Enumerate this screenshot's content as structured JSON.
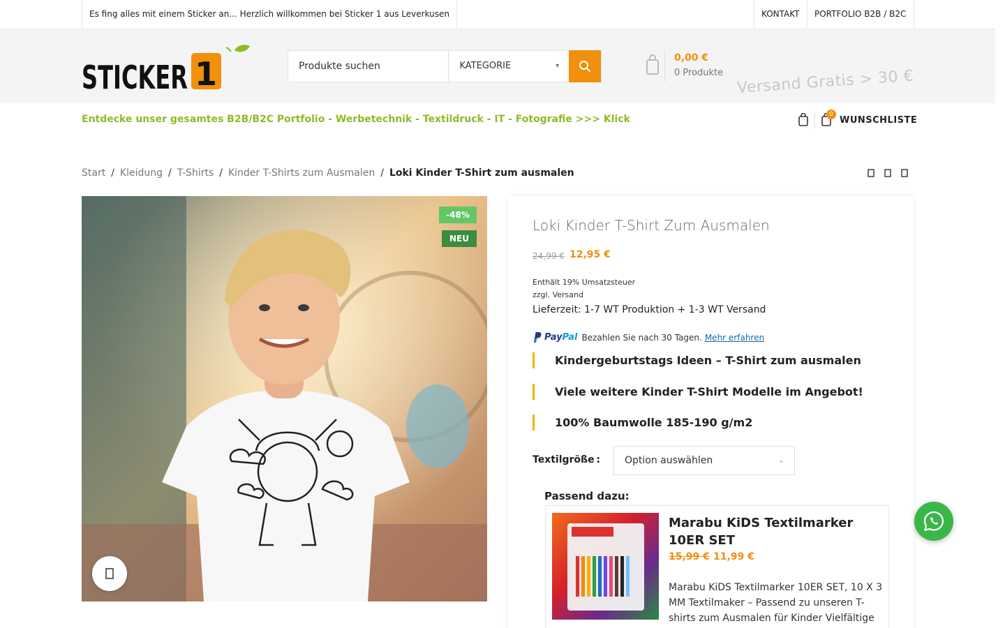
{
  "topbar": {
    "welcome": "Es fing alles mit einem Sticker an... Herzlich willkommen bei Sticker 1 aus Leverkusen",
    "links": [
      "KONTAKT",
      "PORTFOLIO B2B / B2C"
    ]
  },
  "header": {
    "logo_text": "STICKER",
    "logo_number": "1",
    "search_placeholder": "Produkte suchen",
    "category_label": "KATEGORIE",
    "cart_total": "0,00 €",
    "cart_count": "0 Produkte",
    "shipping_ticker": "Versand Gratis > 30 €"
  },
  "promo": "Entdecke unser gesamtes B2B/B2C Portfolio - Werbetechnik - Textildruck - IT - Fotografie >>> Klick",
  "wishlist": {
    "count": "0",
    "label": "WUNSCHLISTE"
  },
  "breadcrumb": {
    "items": [
      "Start",
      "Kleidung",
      "T-Shirts",
      "Kinder T-Shirts zum Ausmalen"
    ],
    "separator": "/",
    "current": "Loki Kinder T-Shirt zum ausmalen"
  },
  "gallery": {
    "badge_sale": "-48%",
    "badge_new": "NEU"
  },
  "product": {
    "title": "Loki Kinder T-Shirt Zum Ausmalen",
    "price_old": "24,99 €",
    "price_new": "12,95 €",
    "tax_note": "Enthält 19% Umsatzsteuer",
    "shipping_note": "zzgl. Versand",
    "delivery": "Lieferzeit: 1-7 WT Produktion + 1-3 WT Versand",
    "paypal": {
      "brand_pay": "Pay",
      "brand_pal": "Pal",
      "text": "Bezahlen Sie nach 30 Tagen.",
      "link": "Mehr erfahren"
    },
    "features": [
      "Kindergeburtstags Ideen – T-Shirt zum ausmalen",
      "Viele weitere Kinder T-Shirt Modelle im Angebot!",
      "100% Baumwolle 185-190 g/m2"
    ],
    "variation_label": "Textilgröße",
    "variation_value": "Option auswählen"
  },
  "bundle": {
    "heading": "Passend dazu:",
    "title": "Marabu KiDS Textilmarker 10ER SET",
    "price_old": "15,99 €",
    "price_new": "11,99 €",
    "description": "Marabu KiDS Textilmarker 10ER SET, 10 X 3 MM Textilmaker – Passend zu unseren T-shirts zum Ausmalen für Kinder Vielfältige"
  },
  "colors": {
    "accent": "#f0900c",
    "promo_green": "#8dbb27",
    "badge_sale": "#63c767",
    "badge_new": "#3d8c40",
    "whatsapp": "#3bb74a"
  }
}
